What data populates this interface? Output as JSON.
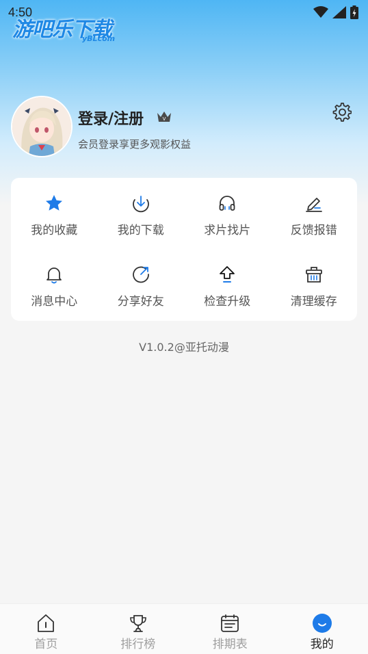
{
  "status_bar": {
    "time": "4:50"
  },
  "watermark": {
    "main": "游吧乐下载",
    "sub": "yBLcom"
  },
  "profile": {
    "title": "登录/注册",
    "subtitle": "会员登录享更多观影权益",
    "crown_letter": "V"
  },
  "menu": {
    "items": [
      {
        "label": "我的收藏",
        "icon": "star-icon"
      },
      {
        "label": "我的下载",
        "icon": "download-icon"
      },
      {
        "label": "求片找片",
        "icon": "headphones-icon"
      },
      {
        "label": "反馈报错",
        "icon": "edit-icon"
      },
      {
        "label": "消息中心",
        "icon": "bell-icon"
      },
      {
        "label": "分享好友",
        "icon": "share-icon"
      },
      {
        "label": "检查升级",
        "icon": "upgrade-icon"
      },
      {
        "label": "清理缓存",
        "icon": "basket-icon"
      }
    ]
  },
  "version": "V1.0.2@亚托动漫",
  "bottom_nav": {
    "items": [
      {
        "label": "首页",
        "icon": "home-icon",
        "active": false
      },
      {
        "label": "排行榜",
        "icon": "trophy-icon",
        "active": false
      },
      {
        "label": "排期表",
        "icon": "calendar-icon",
        "active": false
      },
      {
        "label": "我的",
        "icon": "profile-icon",
        "active": true
      }
    ]
  },
  "colors": {
    "accent": "#1e88e5",
    "header_gradient_top": "#4fb6f4"
  }
}
